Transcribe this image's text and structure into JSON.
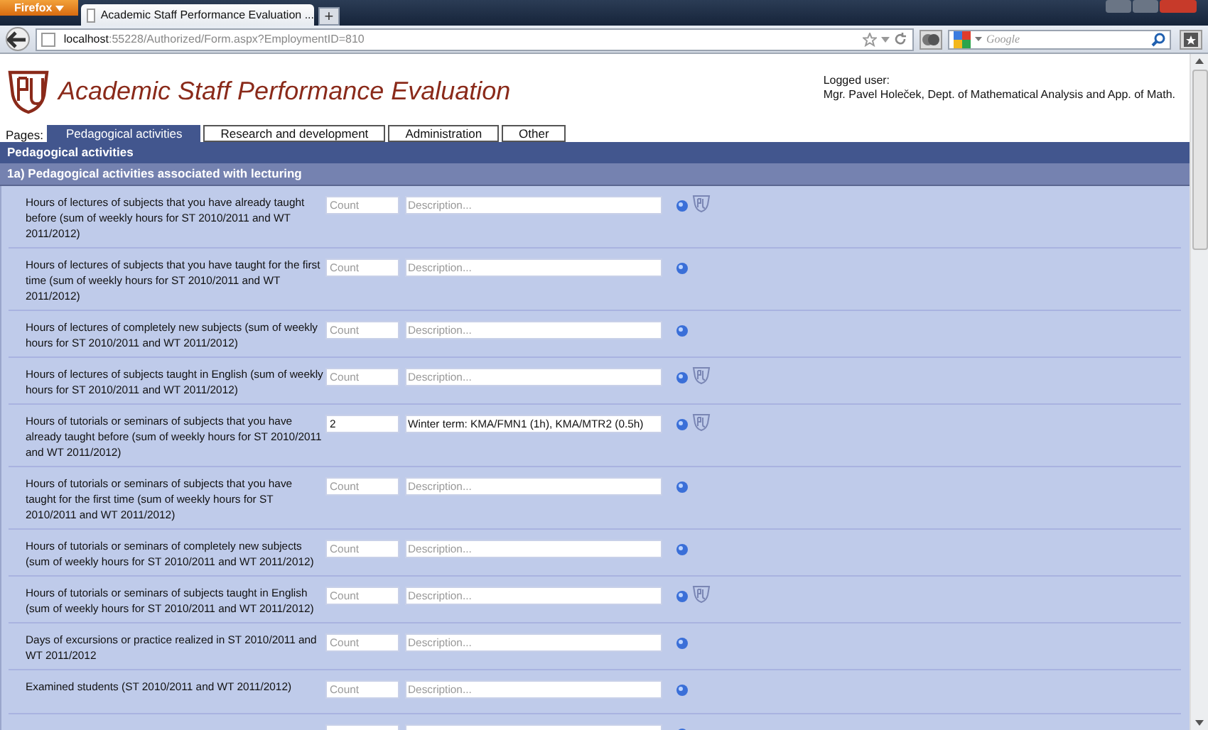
{
  "browser": {
    "menu_button": "Firefox",
    "tab_title": "Academic Staff Performance Evaluation ...",
    "new_tab": "+",
    "url_host": "localhost",
    "url_path": ":55228/Authorized/Form.aspx?EmploymentID=810",
    "search_placeholder": "Google"
  },
  "header": {
    "title": "Academic Staff Performance Evaluation",
    "user_label": "Logged user:",
    "user_name": "Mgr. Pavel Holeček, Dept. of Mathematical Analysis and App. of Math."
  },
  "pages_label": "Pages:",
  "tabs": [
    {
      "label": "Pedagogical activities",
      "selected": true
    },
    {
      "label": "Research and development",
      "selected": false
    },
    {
      "label": "Administration",
      "selected": false
    },
    {
      "label": "Other",
      "selected": false
    }
  ],
  "section_title": "Pedagogical activities",
  "subsection_title": "1a) Pedagogical activities associated with lecturing",
  "rows": [
    {
      "label": "Hours of lectures of subjects that you have already taught before (sum of weekly hours for ST 2010/2011 and WT 2011/2012)",
      "count": {
        "placeholder": "Count"
      },
      "description": {
        "placeholder": "Description..."
      },
      "university_mark": true
    },
    {
      "label": "Hours of lectures of subjects that you have taught for the first time (sum of weekly hours for ST 2010/2011 and WT 2011/2012)",
      "count": {
        "placeholder": "Count"
      },
      "description": {
        "placeholder": "Description..."
      },
      "university_mark": false
    },
    {
      "label": "Hours of lectures of completely new subjects (sum of weekly hours for ST 2010/2011 and WT 2011/2012)",
      "count": {
        "placeholder": "Count"
      },
      "description": {
        "placeholder": "Description..."
      },
      "university_mark": false
    },
    {
      "label": "Hours of lectures of subjects taught in English (sum of weekly hours for ST 2010/2011 and WT 2011/2012)",
      "count": {
        "placeholder": "Count"
      },
      "description": {
        "placeholder": "Description..."
      },
      "university_mark": true
    },
    {
      "label": "Hours of tutorials or seminars of subjects that you have already taught before (sum of weekly hours for ST 2010/2011 and WT 2011/2012)",
      "count": {
        "value": "2"
      },
      "description": {
        "value": "Winter term: KMA/FMN1 (1h), KMA/MTR2 (0.5h)"
      },
      "university_mark": true
    },
    {
      "label": "Hours of tutorials or seminars of subjects that you have taught for the first time (sum of weekly hours for ST 2010/2011 and WT 2011/2012)",
      "count": {
        "placeholder": "Count"
      },
      "description": {
        "placeholder": "Description..."
      },
      "university_mark": false
    },
    {
      "label": "Hours of tutorials or seminars of completely new subjects (sum of weekly hours for ST 2010/2011 and WT 2011/2012)",
      "count": {
        "placeholder": "Count"
      },
      "description": {
        "placeholder": "Description..."
      },
      "university_mark": false
    },
    {
      "label": "Hours of tutorials or seminars of subjects taught in English (sum of weekly hours for ST 2010/2011 and WT 2011/2012)",
      "count": {
        "placeholder": "Count"
      },
      "description": {
        "placeholder": "Description..."
      },
      "university_mark": true
    },
    {
      "label": "Days of excursions or practice realized in ST 2010/2011 and WT 2011/2012",
      "count": {
        "placeholder": "Count"
      },
      "description": {
        "placeholder": "Description..."
      },
      "university_mark": false
    },
    {
      "label": "Examined students (ST 2010/2011 and WT 2011/2012)",
      "count": {
        "placeholder": "Count"
      },
      "description": {
        "placeholder": "Description..."
      },
      "university_mark": false
    },
    {
      "count": {},
      "description": {}
    }
  ]
}
